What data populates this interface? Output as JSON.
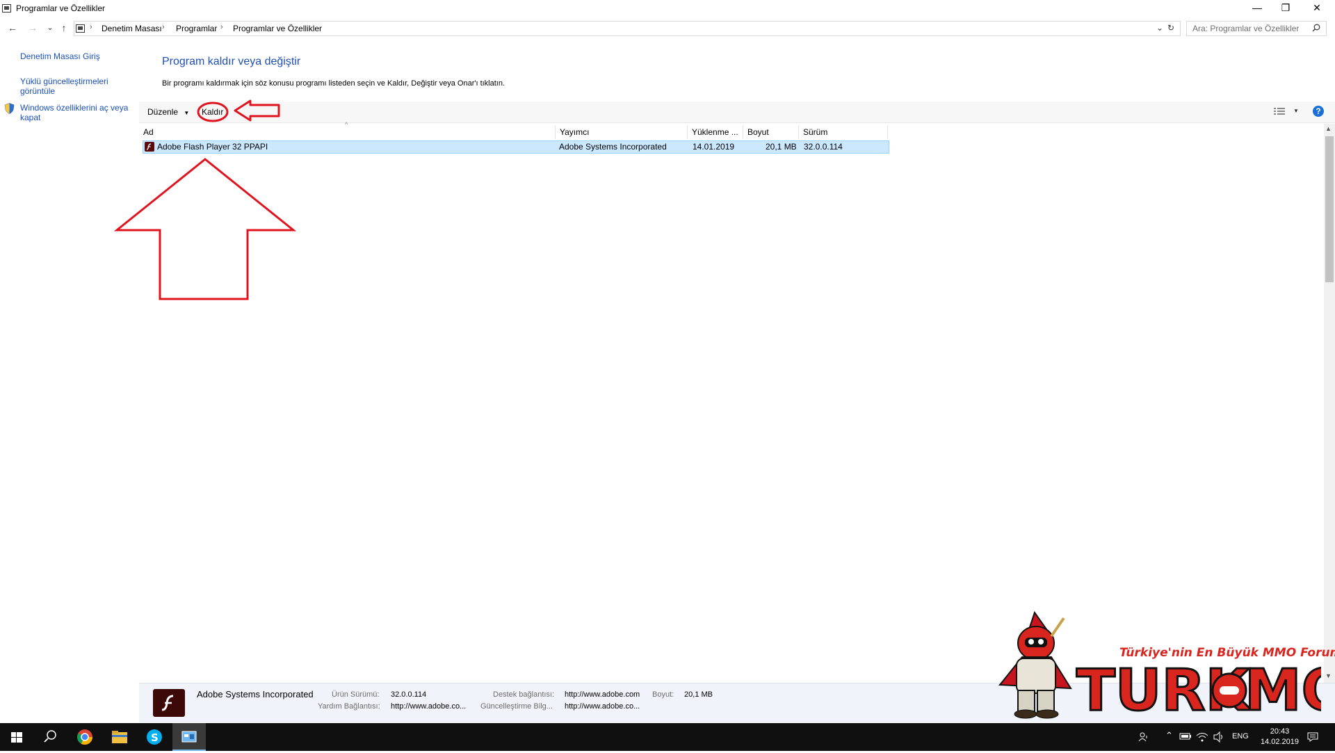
{
  "window": {
    "title": "Programlar ve Özellikler",
    "min_glyph": "—",
    "restore_glyph": "❐",
    "close_glyph": "✕"
  },
  "nav": {
    "back": "←",
    "forward": "→",
    "recent": "⌄",
    "up": "↑"
  },
  "address": {
    "crumbs": [
      "Denetim Masası",
      "Programlar",
      "Programlar ve Özellikler"
    ],
    "dropdown": "⌄",
    "refresh": "↻"
  },
  "search": {
    "placeholder": "Ara: Programlar ve Özellikler"
  },
  "sidebar": {
    "items": [
      {
        "label": "Denetim Masası Giriş"
      },
      {
        "label_line1": "Yüklü güncelleştirmeleri",
        "label_line2": "görüntüle"
      },
      {
        "label_line1": "Windows özelliklerini aç veya",
        "label_line2": "kapat"
      }
    ]
  },
  "main": {
    "title": "Program kaldır veya değiştir",
    "description": "Bir programı kaldırmak için söz konusu programı listeden seçin ve Kaldır, Değiştir veya Onar'ı tıklatın."
  },
  "toolbar": {
    "organize": "Düzenle",
    "uninstall": "Kaldır",
    "help": "?"
  },
  "columns": [
    "Ad",
    "Yayımcı",
    "Yüklenme ...",
    "Boyut",
    "Sürüm"
  ],
  "rows": [
    {
      "name": "Adobe Flash Player 32 PPAPI",
      "publisher": "Adobe Systems Incorporated",
      "installed": "14.01.2019",
      "size": "20,1 MB",
      "version": "32.0.0.114"
    }
  ],
  "details": {
    "publisher": "Adobe Systems Incorporated",
    "product_version_label": "Ürün Sürümü:",
    "product_version": "32.0.0.114",
    "support_link_label": "Destek bağlantısı:",
    "support_link": "http://www.adobe.com",
    "size_label": "Boyut:",
    "size": "20,1 MB",
    "help_link_label": "Yardım Bağlantısı:",
    "help_link": "http://www.adobe.co...",
    "update_info_label": "Güncelleştirme Bilg...",
    "update_info": "http://www.adobe.co..."
  },
  "watermark": {
    "tagline": "Türkiye'nin En Büyük MMO Forumu",
    "logo": "TURKMMO"
  },
  "taskbar": {
    "lang": "ENG",
    "time": "20:43",
    "date": "14.02.2019"
  },
  "colors": {
    "link": "#1a50b8",
    "title": "#1e4fb5",
    "selection": "#cce8ff",
    "annotation_red": "#e0141e",
    "taskbar": "#101010"
  }
}
